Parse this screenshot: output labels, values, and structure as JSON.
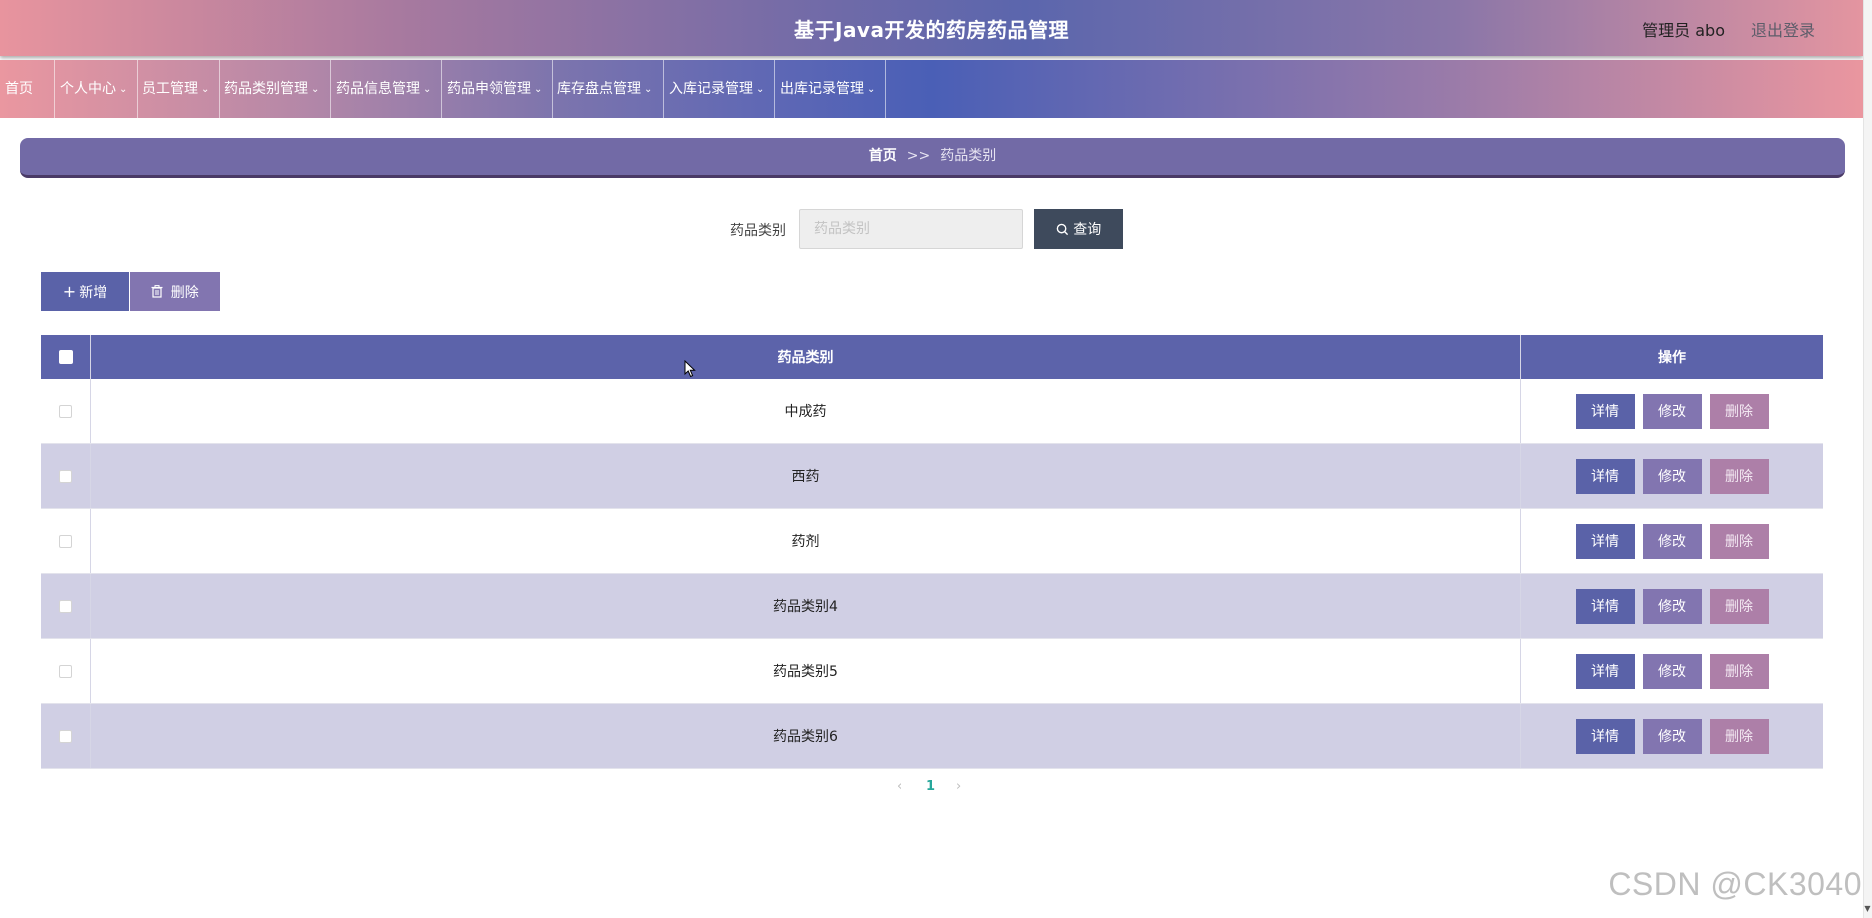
{
  "header": {
    "title": "基于Java开发的药房药品管理",
    "user": "管理员 abo",
    "logout": "退出登录"
  },
  "nav": [
    {
      "label": "首页",
      "dropdown": false
    },
    {
      "label": "个人中心",
      "dropdown": true
    },
    {
      "label": "员工管理",
      "dropdown": true
    },
    {
      "label": "药品类别管理",
      "dropdown": true
    },
    {
      "label": "药品信息管理",
      "dropdown": true
    },
    {
      "label": "药品申领管理",
      "dropdown": true
    },
    {
      "label": "库存盘点管理",
      "dropdown": true
    },
    {
      "label": "入库记录管理",
      "dropdown": true
    },
    {
      "label": "出库记录管理",
      "dropdown": true
    }
  ],
  "breadcrumb": {
    "home": "首页",
    "separator": ">>",
    "current": "药品类别"
  },
  "search": {
    "label": "药品类别",
    "placeholder": "药品类别",
    "value": "",
    "button": "查询"
  },
  "actions": {
    "add": "新增",
    "delete": "删除"
  },
  "table": {
    "columns": [
      "药品类别",
      "操作"
    ],
    "rows": [
      {
        "category": "中成药"
      },
      {
        "category": "西药"
      },
      {
        "category": "药剂"
      },
      {
        "category": "药品类别4"
      },
      {
        "category": "药品类别5"
      },
      {
        "category": "药品类别6"
      }
    ],
    "row_actions": {
      "detail": "详情",
      "edit": "修改",
      "delete": "删除"
    }
  },
  "pagination": {
    "prev": "‹",
    "current_page": "1",
    "next": "›"
  },
  "watermark": "CSDN @CK3040",
  "colors": {
    "primary": "#5a62a8",
    "secondary": "#8275b0",
    "danger": "#ad7fa8",
    "search_button": "#3e4a5c",
    "row_alt": "#d0cfe4",
    "page_active": "#27a79b"
  }
}
